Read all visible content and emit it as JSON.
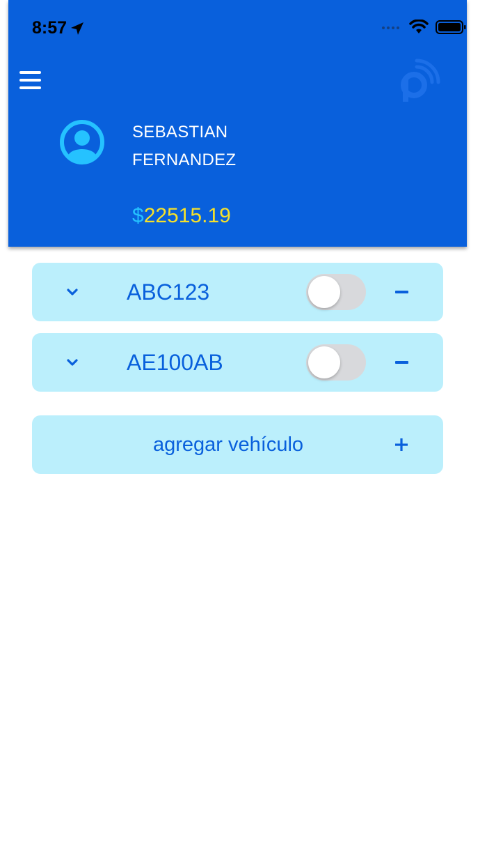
{
  "status_bar": {
    "time": "8:57"
  },
  "header": {
    "user_name_line1": "SEBASTIAN",
    "user_name_line2": "FERNANDEZ",
    "balance_currency": "$",
    "balance_amount": "22515.19"
  },
  "icons": {
    "menu": "hamburger-menu-icon",
    "avatar": "user-avatar-icon",
    "logo": "parking-signal-logo",
    "expand": "chevron-down-icon",
    "remove": "minus-icon",
    "add": "plus-icon"
  },
  "vehicles": [
    {
      "plate": "ABC123",
      "enabled": false
    },
    {
      "plate": "AE100AB",
      "enabled": false
    }
  ],
  "add_vehicle": {
    "label": "agregar vehículo"
  },
  "colors": {
    "primary": "#0960DC",
    "row_bg": "#BBEFFC",
    "currency": "#25C2FF",
    "amount": "#F6E12A",
    "toggle_off": "#D8D9DC"
  }
}
